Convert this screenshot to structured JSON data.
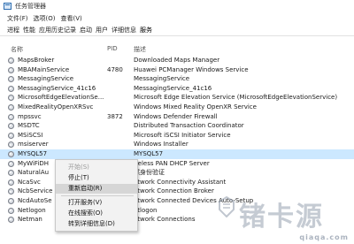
{
  "window": {
    "title": "任务管理器"
  },
  "menu": [
    "文件(F)",
    "选项(O)",
    "查看(V)"
  ],
  "tabs": [
    "进程",
    "性能",
    "应用历史记录",
    "启动",
    "用户",
    "详细信息",
    "服务"
  ],
  "columns": {
    "name": "名称",
    "pid": "PID",
    "desc": "描述"
  },
  "services": [
    {
      "name": "MapsBroker",
      "pid": "",
      "desc": "Downloaded Maps Manager"
    },
    {
      "name": "MBAMainService",
      "pid": "4780",
      "desc": "Huawei PCManager Windows Service"
    },
    {
      "name": "MessagingService",
      "pid": "",
      "desc": "MessagingService"
    },
    {
      "name": "MessagingService_41c16",
      "pid": "",
      "desc": "MessagingService_41c16"
    },
    {
      "name": "MicrosoftEdgeElevationSe...",
      "pid": "",
      "desc": "Microsoft Edge Elevation Service (MicrosoftEdgeElevationService)"
    },
    {
      "name": "MixedRealityOpenXRSvc",
      "pid": "",
      "desc": "Windows Mixed Reality OpenXR Service"
    },
    {
      "name": "mpssvc",
      "pid": "3872",
      "desc": "Windows Defender Firewall"
    },
    {
      "name": "MSDTC",
      "pid": "",
      "desc": "Distributed Transaction Coordinator"
    },
    {
      "name": "MSiSCSI",
      "pid": "",
      "desc": "Microsoft iSCSI Initiator Service"
    },
    {
      "name": "msiserver",
      "pid": "",
      "desc": "Windows Installer"
    },
    {
      "name": "MYSQL57",
      "pid": "",
      "desc": "MYSQL57"
    },
    {
      "name": "MyWiFiDH",
      "pid": "",
      "desc": "ireless PAN DHCP Server"
    },
    {
      "name": "NaturalAu",
      "pid": "",
      "desc": "然身份验证"
    },
    {
      "name": "NcaSvc",
      "pid": "",
      "desc": "etwork Connectivity Assistant"
    },
    {
      "name": "NcbService",
      "pid": "",
      "desc": "etwork Connection Broker"
    },
    {
      "name": "NcdAutoSe",
      "pid": "",
      "desc": "etwork Connected Devices Auto-Setup"
    },
    {
      "name": "Netlogon",
      "pid": "",
      "desc": "etlogon"
    },
    {
      "name": "Netman",
      "pid": "",
      "desc": "etwork Connections"
    }
  ],
  "selected_row": "MYSQL57",
  "context_menu": {
    "start": "开始(S)",
    "stop": "停止(T)",
    "restart": "重新启动(R)",
    "open_services": "打开服务(V)",
    "search_online": "在线搜索(O)",
    "goto_details": "转到详细信息(D)"
  },
  "watermark": {
    "text": "锗卡源",
    "url": "qiaqa.com"
  }
}
